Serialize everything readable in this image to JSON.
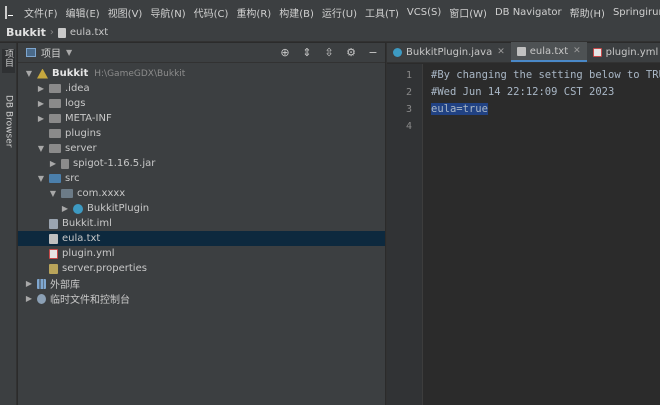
{
  "menu": [
    "文件(F)",
    "编辑(E)",
    "视图(V)",
    "导航(N)",
    "代码(C)",
    "重构(R)",
    "构建(B)",
    "运行(U)",
    "工具(T)",
    "VCS(S)",
    "窗口(W)",
    "DB Navigator",
    "帮助(H)",
    "Springirun"
  ],
  "breadcrumb": {
    "project": "Bukkit",
    "file": "eula.txt"
  },
  "left_strip": {
    "project_tab": "项目",
    "db_tab": "DB Browser"
  },
  "panel": {
    "title": "项目"
  },
  "tree": [
    {
      "label": "Bukkit",
      "hint": "H:\\GameGDX\\Bukkit"
    },
    {
      "label": ".idea"
    },
    {
      "label": "logs"
    },
    {
      "label": "META-INF"
    },
    {
      "label": "plugins"
    },
    {
      "label": "server"
    },
    {
      "label": "spigot-1.16.5.jar"
    },
    {
      "label": "src"
    },
    {
      "label": "com.xxxx"
    },
    {
      "label": "BukkitPlugin"
    },
    {
      "label": "Bukkit.iml"
    },
    {
      "label": "eula.txt"
    },
    {
      "label": "plugin.yml"
    },
    {
      "label": "server.properties"
    },
    {
      "label": "外部库"
    },
    {
      "label": "临时文件和控制台"
    }
  ],
  "tabs": [
    {
      "label": "BukkitPlugin.java"
    },
    {
      "label": "eula.txt"
    },
    {
      "label": "plugin.yml"
    }
  ],
  "editor": {
    "line_numbers": [
      "1",
      "2",
      "3",
      "4"
    ],
    "lines": [
      "#By changing the setting below to TRUE you are indicating your agreement to our EULA",
      "#Wed Jun 14 22:12:09 CST 2023",
      "eula=true",
      ""
    ]
  },
  "colors": {
    "selection": "#214283",
    "tree_selected": "#0d293e",
    "active_tab_underline": "#4a88c7"
  }
}
